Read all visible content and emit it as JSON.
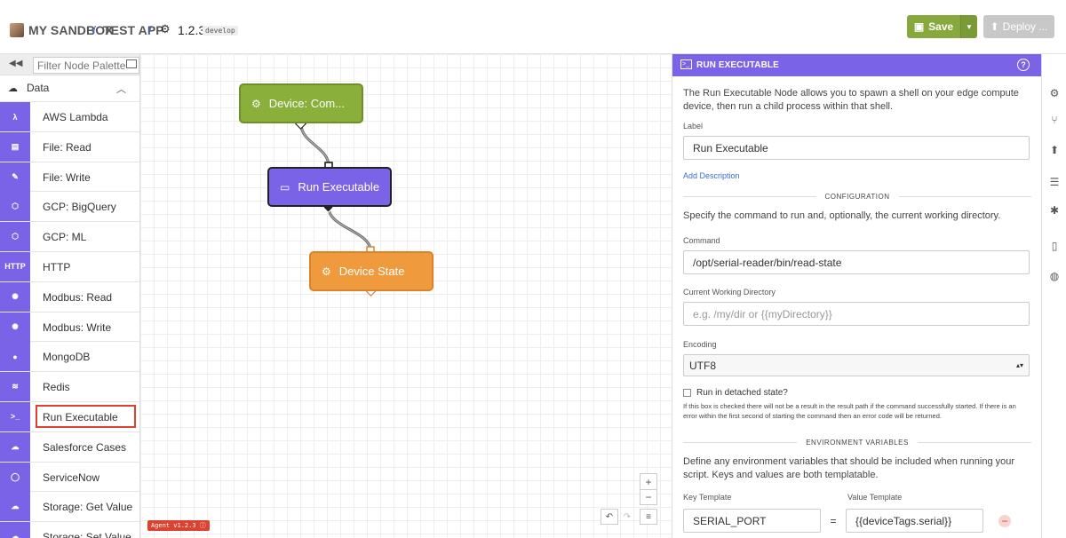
{
  "header": {
    "org": "MY SANDBOX",
    "sep1": "/",
    "app": "TEST APP",
    "sep2": "/",
    "version": "1.2.3",
    "branch": "develop",
    "save_label": "Save",
    "deploy_label": "Deploy ...",
    "colors": {
      "save": "#86a83d",
      "deploy": "#c8c8c8"
    }
  },
  "palette": {
    "filter_placeholder": "Filter Node Palette",
    "category": "Data",
    "items": [
      {
        "label": "AWS Lambda",
        "icon": "aws-lambda-icon",
        "glyph": "λ"
      },
      {
        "label": "File: Read",
        "icon": "file-read-icon",
        "glyph": "▤"
      },
      {
        "label": "File: Write",
        "icon": "file-write-icon",
        "glyph": "✎"
      },
      {
        "label": "GCP: BigQuery",
        "icon": "gcp-bigquery-icon",
        "glyph": "⬡"
      },
      {
        "label": "GCP: ML",
        "icon": "gcp-ml-icon",
        "glyph": "⬡"
      },
      {
        "label": "HTTP",
        "icon": "http-icon",
        "glyph": "HTTP"
      },
      {
        "label": "Modbus: Read",
        "icon": "modbus-read-icon",
        "glyph": "✺"
      },
      {
        "label": "Modbus: Write",
        "icon": "modbus-write-icon",
        "glyph": "✺"
      },
      {
        "label": "MongoDB",
        "icon": "mongodb-icon",
        "glyph": "●"
      },
      {
        "label": "Redis",
        "icon": "redis-icon",
        "glyph": "≋"
      },
      {
        "label": "Run Executable",
        "icon": "terminal-icon",
        "glyph": ">_",
        "selected": true
      },
      {
        "label": "Salesforce Cases",
        "icon": "salesforce-icon",
        "glyph": "☁"
      },
      {
        "label": "ServiceNow",
        "icon": "servicenow-icon",
        "glyph": "◯"
      },
      {
        "label": "Storage: Get Value",
        "icon": "storage-get-icon",
        "glyph": "☁"
      },
      {
        "label": "Storage: Set Value",
        "icon": "storage-set-icon",
        "glyph": "☁"
      }
    ]
  },
  "canvas": {
    "nodes": {
      "device_command": "Device: Com...",
      "run_executable": "Run Executable",
      "device_state": "Device State"
    },
    "agent_badge": "Agent v1.2.3 ⓘ"
  },
  "panel": {
    "title": "RUN EXECUTABLE",
    "description": "The Run Executable Node allows you to spawn a shell on your edge compute device, then run a child process within that shell.",
    "label_label": "Label",
    "label_value": "Run Executable",
    "add_description": "Add Description",
    "config_title": "CONFIGURATION",
    "config_desc": "Specify the command to run and, optionally, the current working directory.",
    "command_label": "Command",
    "command_value": "/opt/serial-reader/bin/read-state",
    "cwd_label": "Current Working Directory",
    "cwd_placeholder": "e.g. /my/dir or {{myDirectory}}",
    "encoding_label": "Encoding",
    "encoding_value": "UTF8",
    "detached_label": "Run in detached state?",
    "detached_help": "If this box is checked there will not be a result in the result path if the command successfully started. If there is an error within the first second of starting the command then an error code will be returned.",
    "env_title": "ENVIRONMENT VARIABLES",
    "env_desc": "Define any environment variables that should be included when running your script. Keys and values are both templatable.",
    "key_label": "Key Template",
    "value_label": "Value Template",
    "env_key": "SERIAL_PORT",
    "env_eq": "=",
    "env_value": "{{deviceTags.serial}}"
  }
}
